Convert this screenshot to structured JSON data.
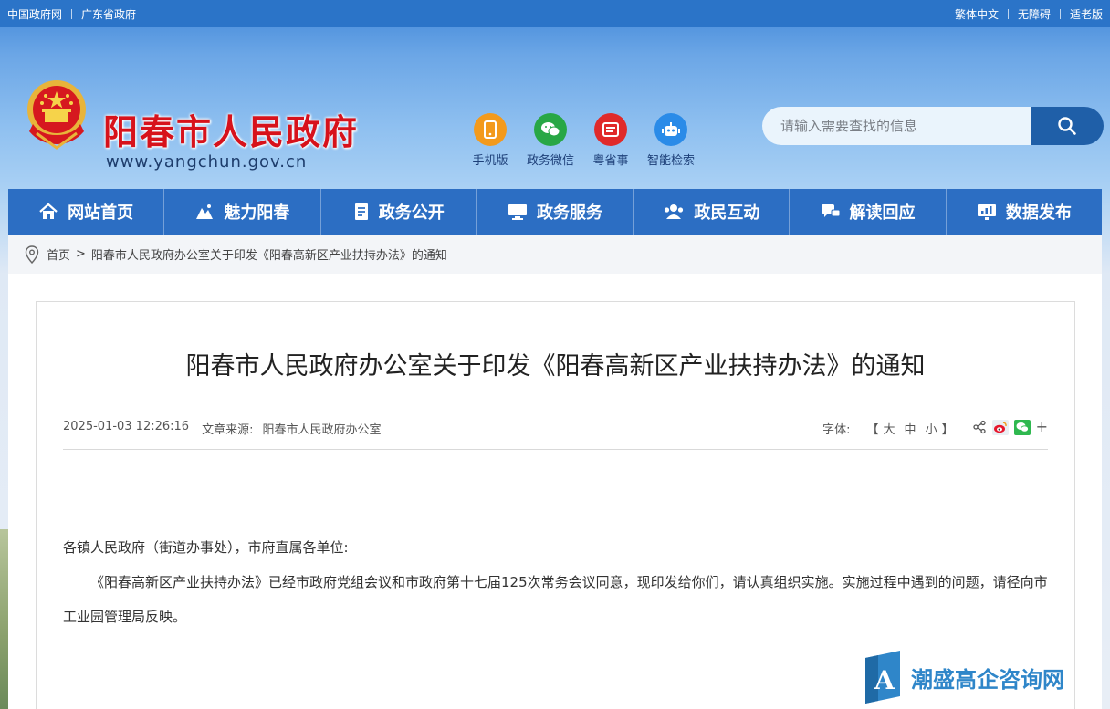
{
  "topbar": {
    "left": [
      "中国政府网",
      "广东省政府"
    ],
    "right": [
      "繁体中文",
      "无障碍",
      "适老版"
    ]
  },
  "header": {
    "title": "阳春市人民政府",
    "url": "www.yangchun.gov.cn",
    "apps": [
      {
        "label": "手机版",
        "icon": "mobile-icon",
        "color": "#f39a1c"
      },
      {
        "label": "政务微信",
        "icon": "wechat-icon",
        "color": "#28a745"
      },
      {
        "label": "粤省事",
        "icon": "yueshengshi-icon",
        "color": "#e02a2a"
      },
      {
        "label": "智能检索",
        "icon": "robot-icon",
        "color": "#2a8be8"
      }
    ],
    "search": {
      "placeholder": "请输入需要查找的信息"
    }
  },
  "nav": [
    {
      "label": "网站首页",
      "icon": "home-icon"
    },
    {
      "label": "魅力阳春",
      "icon": "landscape-icon"
    },
    {
      "label": "政务公开",
      "icon": "document-icon"
    },
    {
      "label": "政务服务",
      "icon": "monitor-icon"
    },
    {
      "label": "政民互动",
      "icon": "people-icon"
    },
    {
      "label": "解读回应",
      "icon": "chat-icon"
    },
    {
      "label": "数据发布",
      "icon": "data-icon"
    }
  ],
  "breadcrumb": {
    "home": "首页",
    "sep": ">",
    "current": "阳春市人民政府办公室关于印发《阳春高新区产业扶持办法》的通知"
  },
  "article": {
    "title": "阳春市人民政府办公室关于印发《阳春高新区产业扶持办法》的通知",
    "date": "2025-01-03 12:26:16",
    "source_label": "文章来源:",
    "source": "阳春市人民政府办公室",
    "font_label": "字体:",
    "font_open": "【",
    "font_sizes": [
      "大",
      "中",
      "小"
    ],
    "font_close": "】",
    "share_plus": "+",
    "greeting": "各镇人民政府（街道办事处），市府直属各单位:",
    "paragraph": "《阳春高新区产业扶持办法》已经市政府党组会议和市政府第十七届125次常务会议同意，现印发给你们，请认真组织实施。实施过程中遇到的问题，请径向市工业园管理局反映。"
  },
  "watermark": {
    "text": "潮盛高企咨询网",
    "logo": "A"
  },
  "colors": {
    "nav": "#2c6ec3",
    "title_red": "#d7121b",
    "topbar": "#2b74c8",
    "search_btn": "#1f5fa8"
  }
}
